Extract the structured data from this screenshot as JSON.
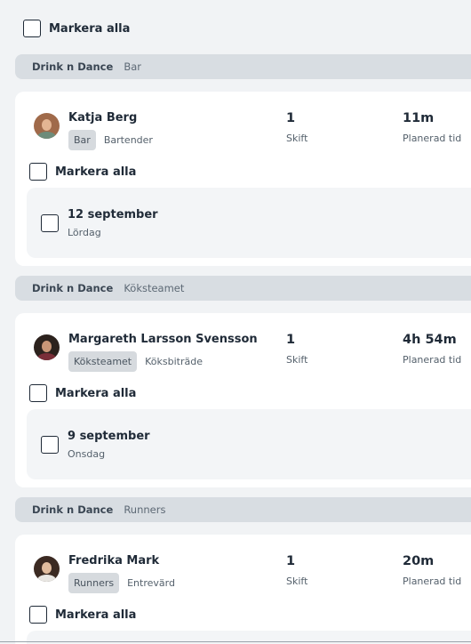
{
  "select_all_label": "Markera alla",
  "groups": [
    {
      "venue": "Drink n Dance",
      "department": "Bar",
      "employee": {
        "name": "Katja Berg",
        "role_tag": "Bar",
        "job_title": "Bartender",
        "shifts_count": "1",
        "shifts_label": "Skift",
        "planned_time": "11m",
        "planned_label": "Planerad tid"
      },
      "select_all_label": "Markera alla",
      "shift": {
        "date": "12 september",
        "weekday": "Lördag"
      }
    },
    {
      "venue": "Drink n Dance",
      "department": "Köksteamet",
      "employee": {
        "name": "Margareth Larsson Svensson",
        "role_tag": "Köksteamet",
        "job_title": "Köksbiträde",
        "shifts_count": "1",
        "shifts_label": "Skift",
        "planned_time": "4h 54m",
        "planned_label": "Planerad tid"
      },
      "select_all_label": "Markera alla",
      "shift": {
        "date": "9 september",
        "weekday": "Onsdag"
      }
    },
    {
      "venue": "Drink n Dance",
      "department": "Runners",
      "employee": {
        "name": "Fredrika Mark",
        "role_tag": "Runners",
        "job_title": "Entrevärd",
        "shifts_count": "1",
        "shifts_label": "Skift",
        "planned_time": "20m",
        "planned_label": "Planerad tid"
      },
      "select_all_label": "Markera alla"
    }
  ],
  "colors": {
    "page_bg": "#f1f3f5",
    "card_bg": "#ffffff",
    "group_header_bg": "#d8dde2",
    "tag_bg": "#d6dade",
    "text_primary": "#1f2a37"
  }
}
